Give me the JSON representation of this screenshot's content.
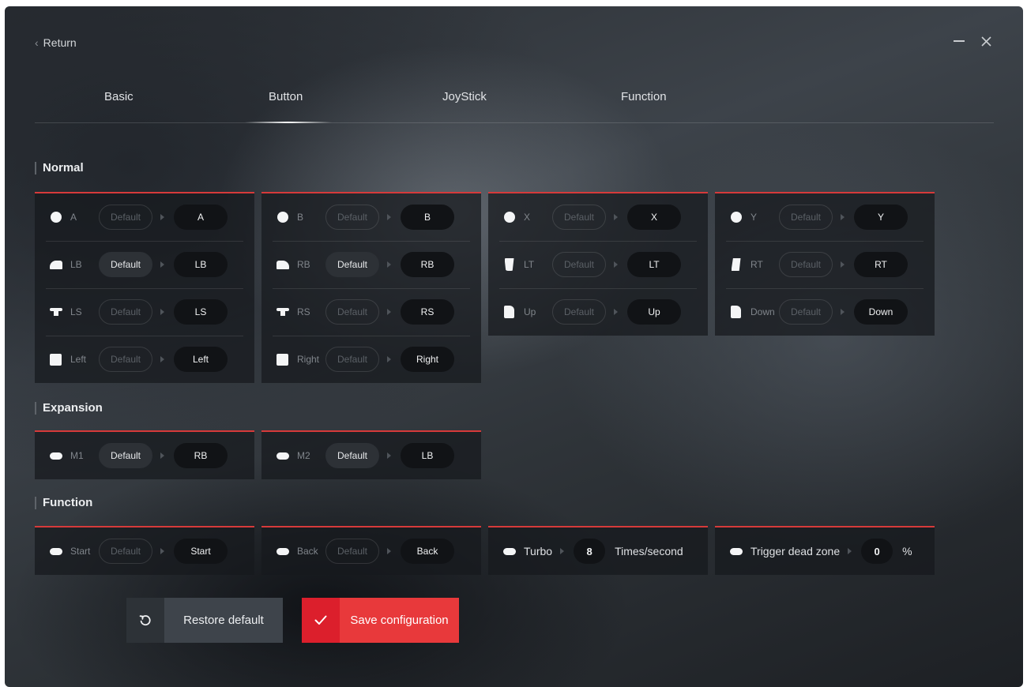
{
  "header": {
    "return_label": "Return"
  },
  "tabs": [
    {
      "label": "Basic"
    },
    {
      "label": "Button",
      "active": true
    },
    {
      "label": "JoyStick"
    },
    {
      "label": "Function"
    }
  ],
  "sections": {
    "normal": "Normal",
    "expansion": "Expansion",
    "function": "Function"
  },
  "accent_color": "#e8393b",
  "normal": {
    "card1": [
      {
        "icon": "face-button-icon",
        "name": "A",
        "default": "Default",
        "mapped": "A"
      },
      {
        "icon": "left-bumper-icon",
        "name": "LB",
        "default": "Default",
        "mapped": "LB",
        "default_active": true
      },
      {
        "icon": "left-stick-icon",
        "name": "LS",
        "default": "Default",
        "mapped": "LS"
      },
      {
        "icon": "dpad-left-icon",
        "name": "Left",
        "default": "Default",
        "mapped": "Left"
      }
    ],
    "card2": [
      {
        "icon": "face-button-icon",
        "name": "B",
        "default": "Default",
        "mapped": "B"
      },
      {
        "icon": "right-bumper-icon",
        "name": "RB",
        "default": "Default",
        "mapped": "RB",
        "default_active": true
      },
      {
        "icon": "right-stick-icon",
        "name": "RS",
        "default": "Default",
        "mapped": "RS"
      },
      {
        "icon": "dpad-right-icon",
        "name": "Right",
        "default": "Default",
        "mapped": "Right"
      }
    ],
    "card3": [
      {
        "icon": "face-button-icon",
        "name": "X",
        "default": "Default",
        "mapped": "X"
      },
      {
        "icon": "left-trigger-icon",
        "name": "LT",
        "default": "Default",
        "mapped": "LT"
      },
      {
        "icon": "dpad-up-icon",
        "name": "Up",
        "default": "Default",
        "mapped": "Up"
      }
    ],
    "card4": [
      {
        "icon": "face-button-icon",
        "name": "Y",
        "default": "Default",
        "mapped": "Y"
      },
      {
        "icon": "right-trigger-icon",
        "name": "RT",
        "default": "Default",
        "mapped": "RT"
      },
      {
        "icon": "dpad-down-icon",
        "name": "Down",
        "default": "Default",
        "mapped": "Down"
      }
    ]
  },
  "expansion": {
    "m1": {
      "icon": "paddle-icon",
      "name": "M1",
      "default": "Default",
      "mapped": "RB"
    },
    "m2": {
      "icon": "paddle-icon",
      "name": "M2",
      "default": "Default",
      "mapped": "LB"
    }
  },
  "function": {
    "start": {
      "icon": "start-icon",
      "name": "Start",
      "default": "Default",
      "mapped": "Start"
    },
    "back": {
      "icon": "back-icon",
      "name": "Back",
      "default": "Default",
      "mapped": "Back"
    },
    "turbo": {
      "icon": "turbo-icon",
      "name": "Turbo",
      "value": "8",
      "unit": "Times/second"
    },
    "dead_zone": {
      "icon": "trigger-icon",
      "name": "Trigger dead zone",
      "value": "0",
      "unit": "%"
    }
  },
  "actions": {
    "restore_label": "Restore default",
    "save_label": "Save configuration"
  }
}
